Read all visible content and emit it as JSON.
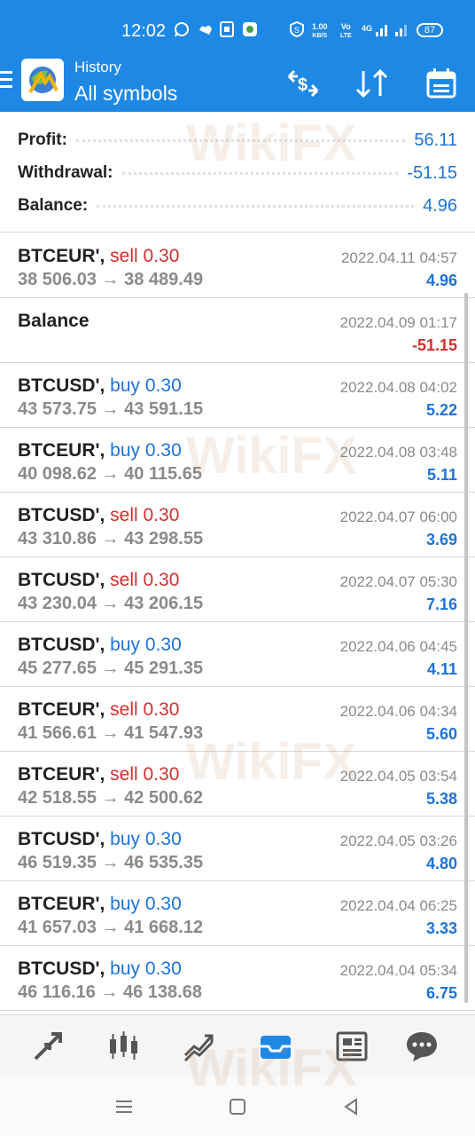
{
  "status_bar": {
    "time": "12:02",
    "net_speed_value": "1.00",
    "net_speed_unit": "KB/S",
    "volte_top": "Vo",
    "volte_bottom": "LTE",
    "network": "4G",
    "battery": "87"
  },
  "app_bar": {
    "title": "History",
    "subtitle": "All symbols"
  },
  "summary": {
    "profit_label": "Profit:",
    "profit_value": "56.11",
    "withdrawal_label": "Withdrawal:",
    "withdrawal_value": "-51.15",
    "balance_label": "Balance:",
    "balance_value": "4.96"
  },
  "deals": [
    {
      "symbol": "BTCEUR',",
      "type": "sell",
      "volume": "0.30",
      "open": "38 506.03",
      "close": "38 489.49",
      "time": "2022.04.11 04:57",
      "profit": "4.96"
    },
    {
      "symbol": "Balance",
      "type": "",
      "volume": "",
      "open": "",
      "close": "",
      "time": "2022.04.09 01:17",
      "profit": "-51.15"
    },
    {
      "symbol": "BTCUSD',",
      "type": "buy",
      "volume": "0.30",
      "open": "43 573.75",
      "close": "43 591.15",
      "time": "2022.04.08 04:02",
      "profit": "5.22"
    },
    {
      "symbol": "BTCEUR',",
      "type": "buy",
      "volume": "0.30",
      "open": "40 098.62",
      "close": "40 115.65",
      "time": "2022.04.08 03:48",
      "profit": "5.11"
    },
    {
      "symbol": "BTCUSD',",
      "type": "sell",
      "volume": "0.30",
      "open": "43 310.86",
      "close": "43 298.55",
      "time": "2022.04.07 06:00",
      "profit": "3.69"
    },
    {
      "symbol": "BTCUSD',",
      "type": "sell",
      "volume": "0.30",
      "open": "43 230.04",
      "close": "43 206.15",
      "time": "2022.04.07 05:30",
      "profit": "7.16"
    },
    {
      "symbol": "BTCUSD',",
      "type": "buy",
      "volume": "0.30",
      "open": "45 277.65",
      "close": "45 291.35",
      "time": "2022.04.06 04:45",
      "profit": "4.11"
    },
    {
      "symbol": "BTCEUR',",
      "type": "sell",
      "volume": "0.30",
      "open": "41 566.61",
      "close": "41 547.93",
      "time": "2022.04.06 04:34",
      "profit": "5.60"
    },
    {
      "symbol": "BTCEUR',",
      "type": "sell",
      "volume": "0.30",
      "open": "42 518.55",
      "close": "42 500.62",
      "time": "2022.04.05 03:54",
      "profit": "5.38"
    },
    {
      "symbol": "BTCUSD',",
      "type": "buy",
      "volume": "0.30",
      "open": "46 519.35",
      "close": "46 535.35",
      "time": "2022.04.05 03:26",
      "profit": "4.80"
    },
    {
      "symbol": "BTCEUR',",
      "type": "buy",
      "volume": "0.30",
      "open": "41 657.03",
      "close": "41 668.12",
      "time": "2022.04.04 06:25",
      "profit": "3.33"
    },
    {
      "symbol": "BTCUSD',",
      "type": "buy",
      "volume": "0.30",
      "open": "46 116.16",
      "close": "46 138.68",
      "time": "2022.04.04 05:34",
      "profit": "6.75"
    }
  ],
  "arrow_glyph": "→",
  "watermark_text": "WikiFX",
  "colors": {
    "accent": "#1e88e5",
    "positive": "#1e73d8",
    "negative": "#d32f2f",
    "muted": "#8a8a8a"
  },
  "icons": {
    "app_bar": [
      "menu-icon",
      "app-logo-icon",
      "currency-icon",
      "sort-icon",
      "calendar-icon"
    ],
    "bottom_nav": [
      "quotes-icon",
      "chart-icon",
      "trade-icon",
      "history-icon",
      "news-icon",
      "chat-icon"
    ],
    "system_nav": [
      "recents-icon",
      "home-icon",
      "back-icon"
    ]
  },
  "bottom_nav_active": "history-icon"
}
